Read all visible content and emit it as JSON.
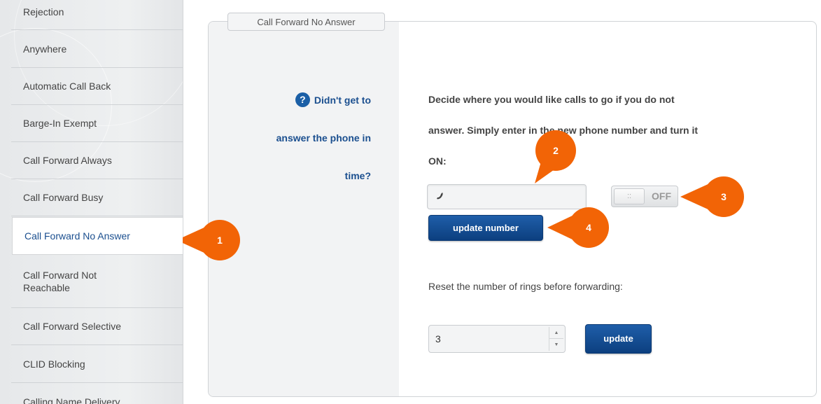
{
  "sidebar": {
    "items": [
      {
        "label": "Rejection"
      },
      {
        "label": "Anywhere"
      },
      {
        "label": "Automatic Call Back"
      },
      {
        "label": "Barge-In Exempt"
      },
      {
        "label": "Call Forward Always"
      },
      {
        "label": "Call Forward Busy"
      },
      {
        "label": "Call Forward No Answer",
        "active": true
      },
      {
        "label": "Call Forward Not Reachable"
      },
      {
        "label": "Call Forward Selective"
      },
      {
        "label": "CLID Blocking"
      },
      {
        "label": "Calling Name Delivery"
      }
    ]
  },
  "panel": {
    "tab_label": "Call Forward No Answer",
    "help": {
      "icon": "question-icon",
      "icon_glyph": "?",
      "lines": [
        "Didn't get to",
        "answer the phone in",
        "time?"
      ]
    },
    "description_lines": [
      "Decide where you would like calls to go if you do not",
      "answer. Simply enter in the new phone number and turn it",
      "ON:"
    ],
    "phone_input": {
      "value": "",
      "placeholder": "",
      "icon": "phone-icon"
    },
    "toggle": {
      "state": "OFF",
      "knob_glyph": "::"
    },
    "update_number_label": "update number",
    "reset_label": "Reset the number of rings before forwarding:",
    "rings": {
      "value": "3",
      "up_glyph": "▲",
      "down_glyph": "▼"
    },
    "update_label": "update"
  },
  "callouts": [
    "1",
    "2",
    "3",
    "4"
  ],
  "colors": {
    "accent": "#1b4f8f",
    "button": "#0c3f7f",
    "callout": "#f26406"
  }
}
